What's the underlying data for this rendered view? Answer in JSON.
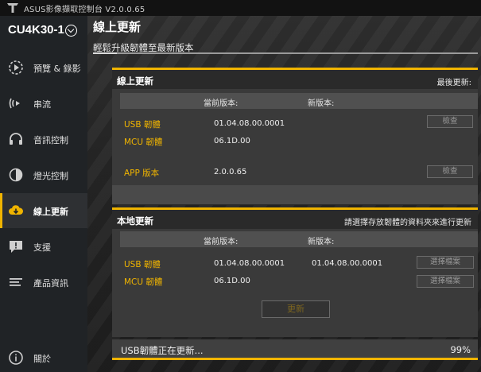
{
  "app": {
    "title": "ASUS影像擷取控制台 V2.0.0.65"
  },
  "sidebar": {
    "device": "CU4K30-1",
    "items": [
      {
        "label": "預覽 & 錄影",
        "icon": "play-circle-icon"
      },
      {
        "label": "串流",
        "icon": "stream-icon"
      },
      {
        "label": "音訊控制",
        "icon": "headphones-icon"
      },
      {
        "label": "燈光控制",
        "icon": "lighting-icon"
      },
      {
        "label": "線上更新",
        "icon": "cloud-download-icon",
        "active": true
      },
      {
        "label": "支援",
        "icon": "support-icon"
      },
      {
        "label": "產品資訊",
        "icon": "product-info-icon"
      }
    ],
    "about": {
      "label": "關於",
      "icon": "info-icon"
    }
  },
  "main": {
    "title": "線上更新",
    "subtitle": "輕鬆升級韌體至最新版本"
  },
  "online_update": {
    "title": "線上更新",
    "last_update_label": "最後更新:",
    "col_current": "當前版本:",
    "col_new": "新版本:",
    "rows": [
      {
        "label": "USB 韌體",
        "current": "01.04.08.00.0001",
        "new": ""
      },
      {
        "label": "MCU 韌體",
        "current": "06.1D.00",
        "new": ""
      },
      {
        "label": "APP 版本",
        "current": "2.0.0.65",
        "new": ""
      }
    ],
    "check_label": "檢查"
  },
  "local_update": {
    "title": "本地更新",
    "hint": "請選擇存放韌體的資料夾來進行更新",
    "col_current": "當前版本:",
    "col_new": "新版本:",
    "rows": [
      {
        "label": "USB 韌體",
        "current": "01.04.08.00.0001",
        "new": "01.04.08.00.0001"
      },
      {
        "label": "MCU 韌體",
        "current": "06.1D.00",
        "new": ""
      }
    ],
    "choose_file_label": "選擇檔案",
    "update_label": "更新"
  },
  "status": {
    "text": "USB韌體正在更新...",
    "percent": "99%",
    "progress": 0.99
  },
  "colors": {
    "accent": "#f0b400",
    "sidebar_bg": "#202326",
    "panel_bg": "#3a3a3a"
  }
}
